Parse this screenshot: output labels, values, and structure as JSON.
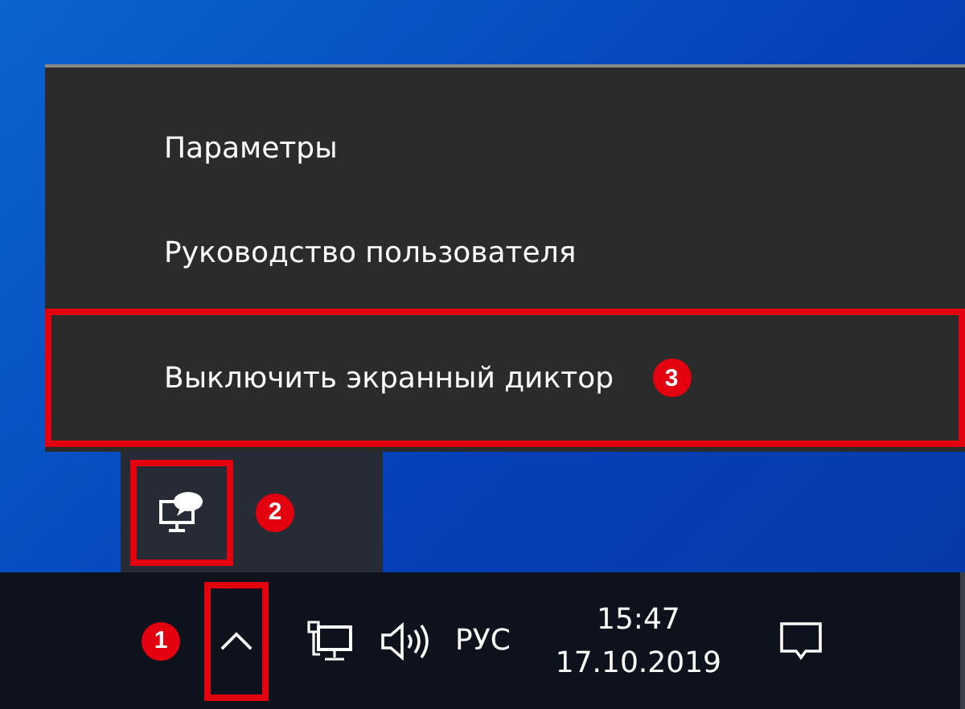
{
  "context_menu": {
    "items": [
      {
        "label": "Параметры"
      },
      {
        "label": "Руководство пользователя"
      },
      {
        "label": "Выключить экранный диктор",
        "callout": "3"
      }
    ]
  },
  "tray_overflow": {
    "callout": "2"
  },
  "taskbar": {
    "overflow_button": {
      "callout": "1"
    },
    "language": "РУС",
    "time": "15:47",
    "date": "17.10.2019"
  }
}
